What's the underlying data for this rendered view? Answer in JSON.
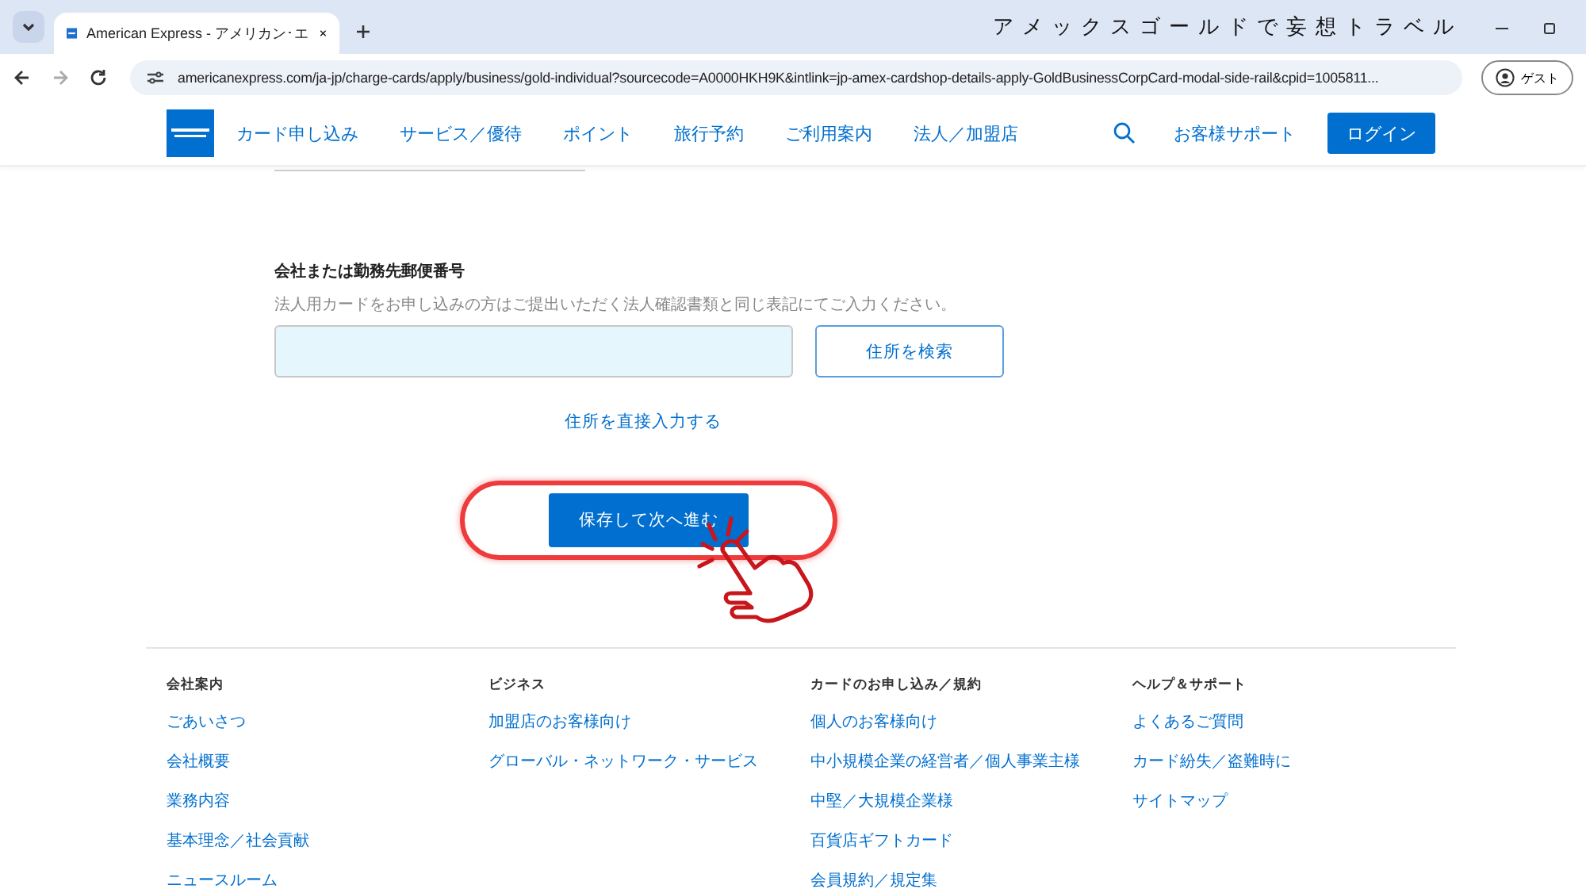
{
  "browser": {
    "tab_title": "American Express - アメリカン･エ",
    "address": "americanexpress.com/ja-jp/charge-cards/apply/business/gold-individual?sourcecode=A0000HKH9K&intlink=jp-amex-cardshop-details-apply-GoldBusinessCorpCard-modal-side-rail&cpid=1005811...",
    "profile_label": "ゲスト"
  },
  "overlay_title": "アメックスゴールドで妄想トラベル",
  "nav": {
    "items": [
      "カード申し込み",
      "サービス／優待",
      "ポイント",
      "旅行予約",
      "ご利用案内",
      "法人／加盟店"
    ],
    "support": "お客様サポート",
    "login": "ログイン"
  },
  "form": {
    "label": "会社または勤務先郵便番号",
    "hint": "法人用カードをお申し込みの方はご提出いただく法人確認書類と同じ表記にてご入力ください。",
    "search_button": "住所を検索",
    "manual_link": "住所を直接入力する",
    "submit": "保存して次へ進む"
  },
  "footer": {
    "columns": [
      {
        "heading": "会社案内",
        "links": [
          "ごあいさつ",
          "会社概要",
          "業務内容",
          "基本理念／社会貢献",
          "ニュースルーム"
        ]
      },
      {
        "heading": "ビジネス",
        "links": [
          "加盟店のお客様向け",
          "グローバル・ネットワーク・サービス"
        ]
      },
      {
        "heading": "カードのお申し込み／規約",
        "links": [
          "個人のお客様向け",
          "中小規模企業の経営者／個人事業主様",
          "中堅／大規模企業様",
          "百貨店ギフトカード",
          "会員規約／規定集"
        ]
      },
      {
        "heading": "ヘルプ＆サポート",
        "links": [
          "よくあるご質問",
          "カード紛失／盗難時に",
          "サイトマップ"
        ]
      }
    ]
  }
}
